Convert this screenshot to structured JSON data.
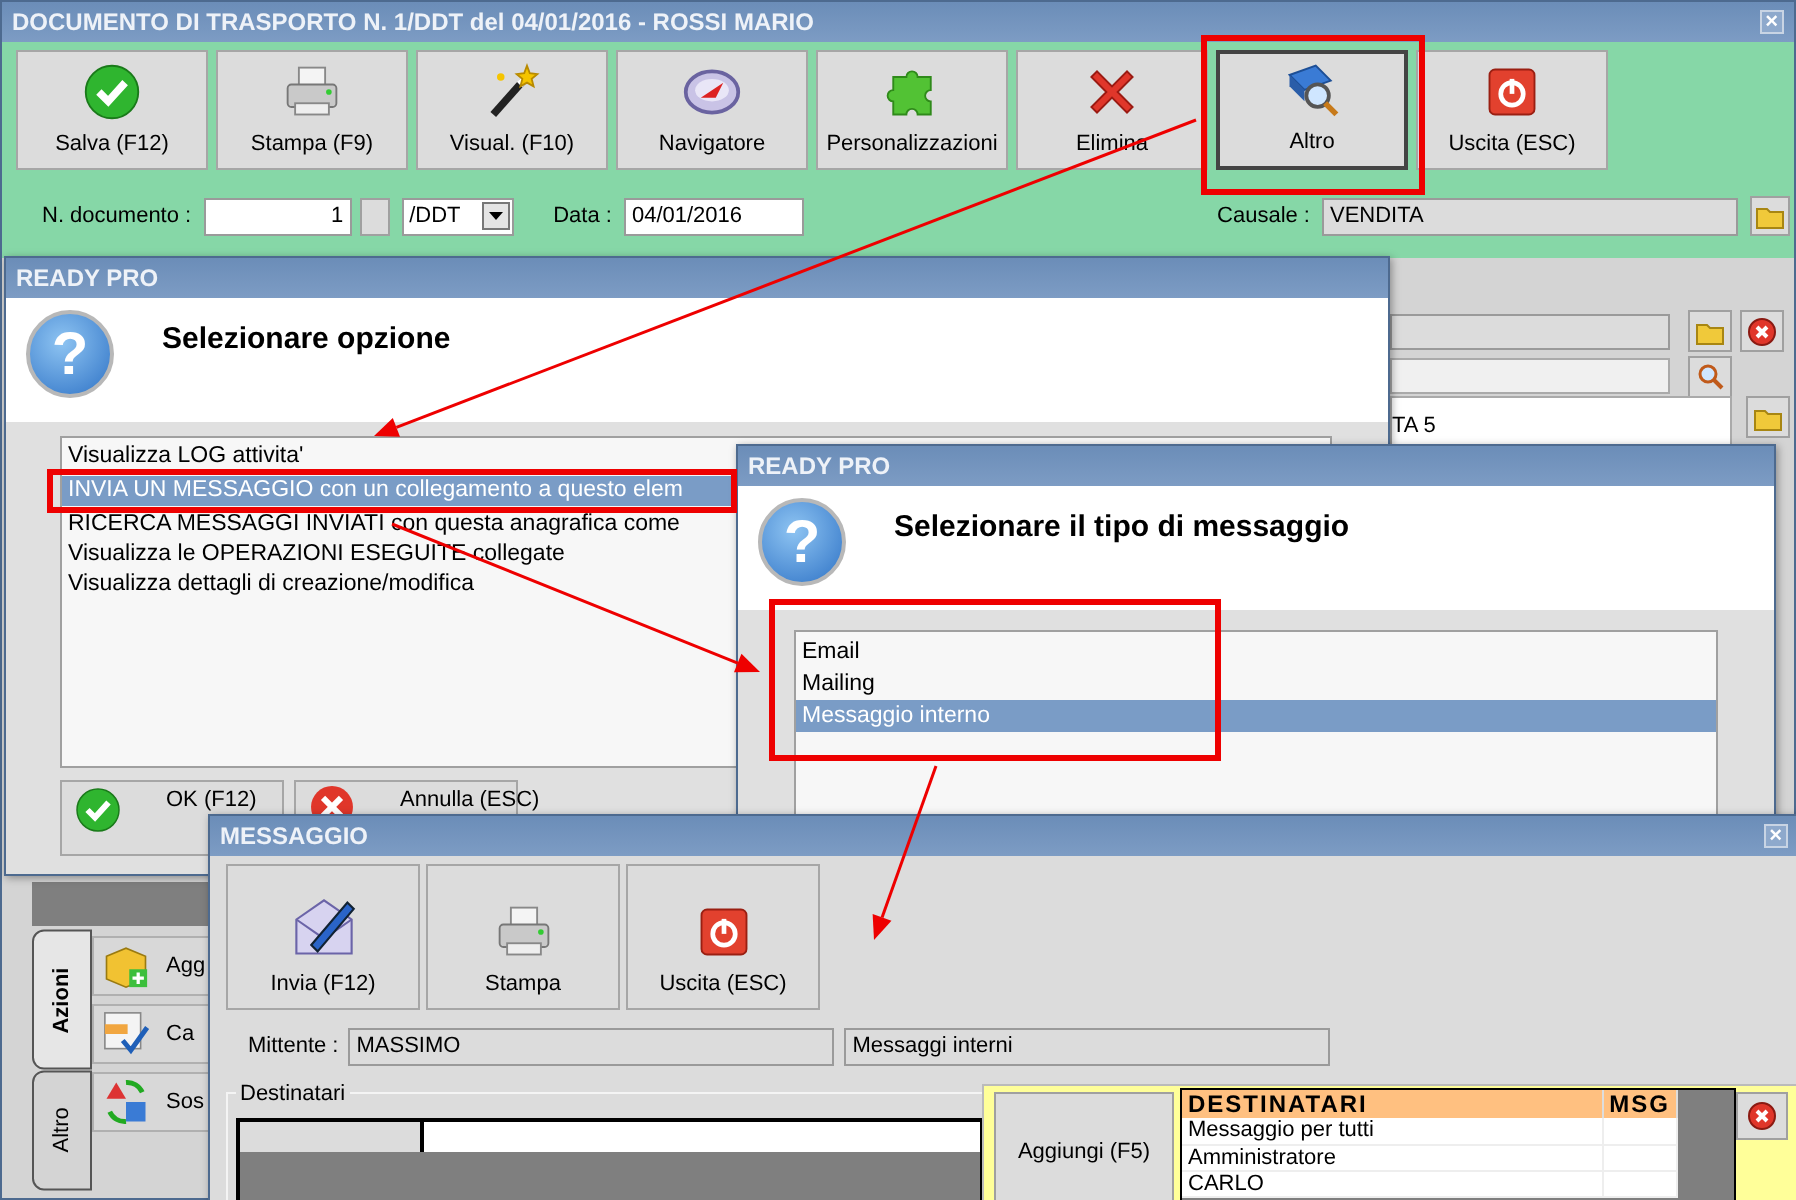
{
  "main_window": {
    "title": "DOCUMENTO DI TRASPORTO N. 1/DDT del 04/01/2016 - ROSSI MARIO",
    "close": "×",
    "toolbar": [
      {
        "label": "Salva (F12)",
        "pressed": false
      },
      {
        "label": "Stampa (F9)",
        "pressed": false
      },
      {
        "label": "Visual. (F10)",
        "pressed": false
      },
      {
        "label": "Navigatore",
        "pressed": false
      },
      {
        "label": "Personalizzazioni",
        "pressed": false
      },
      {
        "label": "Elimina",
        "pressed": false
      },
      {
        "label": "Altro",
        "pressed": true
      },
      {
        "label": "Uscita (ESC)",
        "pressed": false
      }
    ],
    "doc_number_label": "N. documento :",
    "doc_number": "1",
    "series": "/DDT",
    "date_label": "Data :",
    "date": "04/01/2016",
    "causale_label": "Causale :",
    "causale": "VENDITA",
    "background_text": "TA 5",
    "side_tabs": [
      {
        "label": "Azioni",
        "selected": true
      },
      {
        "label": "Altro",
        "selected": false
      }
    ],
    "actions": [
      "Agg",
      "Ca",
      "Sos"
    ]
  },
  "option_dialog": {
    "title": "READY PRO",
    "icon": "?",
    "heading": "Selezionare opzione",
    "options": [
      {
        "label": "Visualizza LOG attivita'",
        "selected": false
      },
      {
        "label": "INVIA UN MESSAGGIO con un collegamento a questo elem",
        "selected": true
      },
      {
        "label": "RICERCA MESSAGGI INVIATI con questa anagrafica come",
        "selected": false
      },
      {
        "label": "Visualizza le OPERAZIONI ESEGUITE collegate",
        "selected": false
      },
      {
        "label": "Visualizza dettagli di creazione/modifica",
        "selected": false
      }
    ],
    "buttons": [
      "OK (F12)",
      "Annulla (ESC)"
    ]
  },
  "type_dialog": {
    "title": "READY PRO",
    "icon": "?",
    "heading": "Selezionare il tipo di messaggio",
    "options": [
      {
        "label": "Email",
        "selected": false
      },
      {
        "label": "Mailing",
        "selected": false
      },
      {
        "label": "Messaggio interno",
        "selected": true
      }
    ]
  },
  "message_window": {
    "title": "MESSAGGIO",
    "close": "×",
    "toolbar": [
      "Invia (F12)",
      "Stampa",
      "Uscita (ESC)"
    ],
    "sender_label": "Mittente :",
    "sender": "MASSIMO",
    "message_type": "Messaggi interni",
    "recipients_group": "Destinatari",
    "add_button": "Aggiungi (F5)",
    "recipients_table": {
      "columns": [
        "DESTINATARI",
        "MSG"
      ],
      "rows": [
        "Messaggio per tutti",
        "Amministratore",
        "CARLO"
      ]
    }
  }
}
